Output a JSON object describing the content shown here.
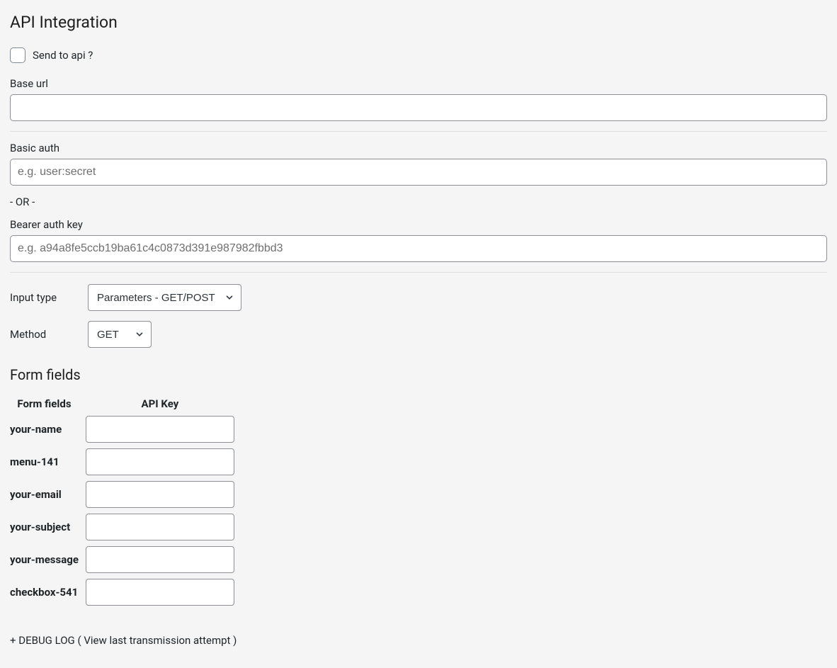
{
  "title": "API Integration",
  "send_to_api": {
    "label": "Send to api ?",
    "checked": false
  },
  "base_url": {
    "label": "Base url",
    "value": ""
  },
  "basic_auth": {
    "label": "Basic auth",
    "placeholder": "e.g. user:secret",
    "value": ""
  },
  "or_separator": "- OR -",
  "bearer": {
    "label": "Bearer auth key",
    "placeholder": "e.g. a94a8fe5ccb19ba61c4c0873d391e987982fbbd3",
    "value": ""
  },
  "input_type": {
    "label": "Input type",
    "selected": "Parameters - GET/POST"
  },
  "method": {
    "label": "Method",
    "selected": "GET"
  },
  "form_fields_section": {
    "title": "Form fields",
    "col_form_fields": "Form fields",
    "col_api_key": "API Key",
    "rows": [
      {
        "name": "your-name",
        "api_key": ""
      },
      {
        "name": "menu-141",
        "api_key": ""
      },
      {
        "name": "your-email",
        "api_key": ""
      },
      {
        "name": "your-subject",
        "api_key": ""
      },
      {
        "name": "your-message",
        "api_key": ""
      },
      {
        "name": "checkbox-541",
        "api_key": ""
      }
    ]
  },
  "debug_log": "+ DEBUG LOG ( View last transmission attempt )"
}
